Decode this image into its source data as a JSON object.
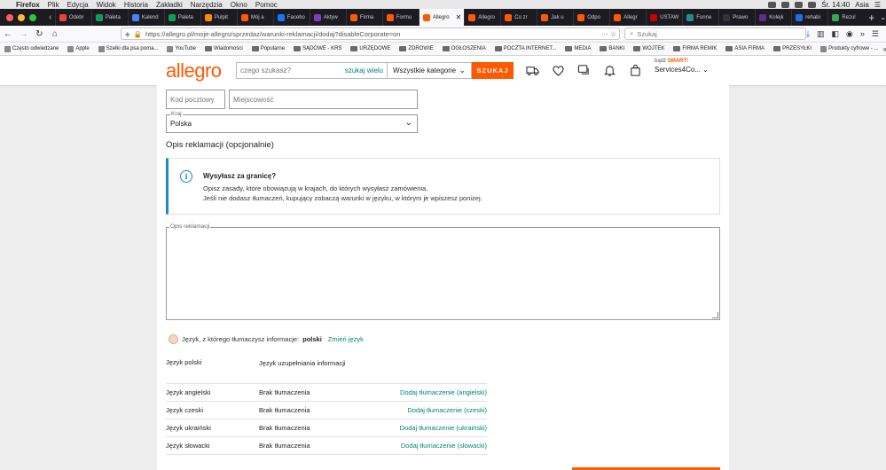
{
  "macos_menubar": {
    "apple": "",
    "items": [
      "Firefox",
      "Plik",
      "Edycja",
      "Widok",
      "Historia",
      "Zakładki",
      "Narzędzia",
      "Okno",
      "Pomoc"
    ],
    "clock": "Śr. 14:40",
    "user": "Asia"
  },
  "tabs": [
    {
      "label": "Odebr",
      "color": "#ea4335"
    },
    {
      "label": "Paleta",
      "color": "#0f9d58"
    },
    {
      "label": "Kalend",
      "color": "#4285f4"
    },
    {
      "label": "Paleta",
      "color": "#0f9d58"
    },
    {
      "label": "Pulpit",
      "color": "#ff8a00"
    },
    {
      "label": "Mój a",
      "color": "#ff5a00"
    },
    {
      "label": "Facebo",
      "color": "#1877f2"
    },
    {
      "label": "Aktyw",
      "color": "#7b3fbf"
    },
    {
      "label": "Firma",
      "color": "#ff5a00"
    },
    {
      "label": "Formu",
      "color": "#ff5a00"
    },
    {
      "label": "Allegro",
      "color": "#ff5a00"
    },
    {
      "label": "Co zr",
      "color": "#ff5a00"
    },
    {
      "label": "Jak u",
      "color": "#ff5a00"
    },
    {
      "label": "Odpo",
      "color": "#ff5a00"
    },
    {
      "label": "Allegr",
      "color": "#ff5a00"
    },
    {
      "label": "USTAW",
      "color": "#cc0000"
    },
    {
      "label": "Funne",
      "color": "#1e8f8f"
    },
    {
      "label": "Prawo",
      "color": "#333333"
    },
    {
      "label": "Kolejk",
      "color": "#5c2d91"
    },
    {
      "label": "rehabi",
      "color": "#1a73e8"
    },
    {
      "label": "Rezul",
      "color": "#34a853"
    }
  ],
  "active_tab": {
    "label": "Allegro",
    "close": "✕"
  },
  "tab_strip": {
    "new_tab": "+",
    "menu": "⌄"
  },
  "browser": {
    "url": "https://allegro.pl/moje-allegro/sprzedaz/warunki-reklamacji/dodaj?disableCorporate=on",
    "search_placeholder": "Szukaj",
    "url_actions": "··· ☆"
  },
  "bookmarks": [
    {
      "label": "Często odwiedzane",
      "type": "gear"
    },
    {
      "label": "Apple",
      "type": "apple"
    },
    {
      "label": "Szelki dla psa poma...",
      "type": "page"
    },
    {
      "label": "YouTube",
      "type": "page"
    },
    {
      "label": "Wiadomości",
      "type": "folder"
    },
    {
      "label": "Popularne",
      "type": "folder"
    },
    {
      "label": "SĄDOWE - KRS",
      "type": "folder"
    },
    {
      "label": "URZĘDOWE",
      "type": "folder"
    },
    {
      "label": "ZDROWIE",
      "type": "folder"
    },
    {
      "label": "OGŁOSZENIA",
      "type": "folder"
    },
    {
      "label": "POCZTA INTERNET...",
      "type": "folder"
    },
    {
      "label": "MEDIA",
      "type": "folder"
    },
    {
      "label": "BANKI",
      "type": "folder"
    },
    {
      "label": "WOJTEK",
      "type": "folder"
    },
    {
      "label": "FIRMA REMIK",
      "type": "folder"
    },
    {
      "label": "ASIA FIRMA",
      "type": "folder"
    },
    {
      "label": "PRZESYŁKI",
      "type": "folder"
    },
    {
      "label": "Produkty cyfrowe - ...",
      "type": "page"
    }
  ],
  "bookmarks_more": "»",
  "header": {
    "logo": "allegro",
    "search_placeholder": "czego szukasz?",
    "search_many": "szukaj wielu",
    "category": "Wszystkie kategorie",
    "search_button": "SZUKAJ",
    "smart_prefix": "bądź",
    "smart": "SMART!",
    "account": "Services4Co..."
  },
  "form": {
    "postal_code_placeholder": "Kod pocztowy",
    "city_placeholder": "Miejscowość",
    "country_label": "Kraj",
    "country_value": "Polska",
    "section_title": "Opis reklamacji (opcjonalnie)",
    "info_title": "Wysyłasz za granicę?",
    "info_line1": "Opisz zasady, które obowiązują w krajach, do których wysyłasz zamówienia.",
    "info_line2": "Jeśli nie dodasz tłumaczeń, kupujący zobaczą warunki w języku, w którym je wpiszesz poniżej.",
    "textarea_label": "Opis reklamacji",
    "lang_prefix": "Język, z którego tłumaczysz informacje:",
    "lang_value": "polski",
    "lang_change": "Zmień język"
  },
  "lang_table": {
    "headers": [
      "Język polski",
      "Język uzupełniania informacji"
    ],
    "rows": [
      {
        "lang": "Język angielski",
        "status": "Brak tłumaczenia",
        "action": "Dodaj tłumaczenie (angielski)"
      },
      {
        "lang": "Język czeski",
        "status": "Brak tłumaczenia",
        "action": "Dodaj tłumaczenie (czeski)"
      },
      {
        "lang": "Język ukraiński",
        "status": "Brak tłumaczenia",
        "action": "Dodaj tłumaczenie (ukraiński)"
      },
      {
        "lang": "Język słowacki",
        "status": "Brak tłumaczenia",
        "action": "Dodaj tłumaczenie (słowacki)"
      }
    ]
  },
  "colors": {
    "brand": "#ff5a00",
    "link": "#008673",
    "info": "#1d89c9"
  }
}
